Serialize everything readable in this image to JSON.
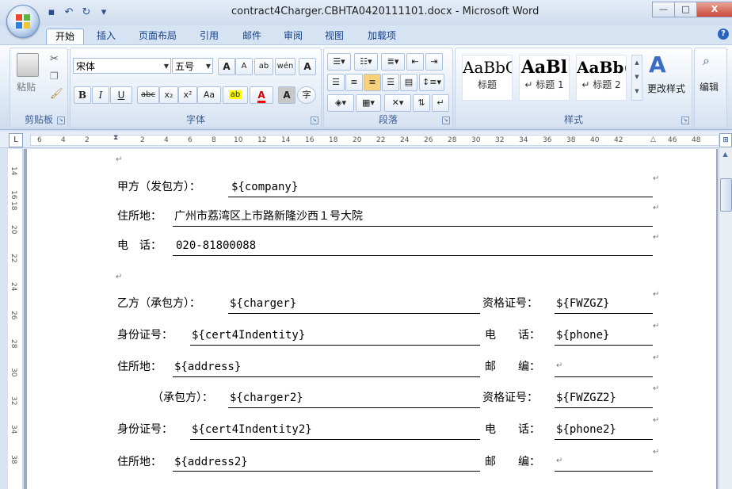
{
  "window": {
    "title": "contract4Charger.CBHTA0420111101.docx - Microsoft Word",
    "controls": {
      "minimize": "—",
      "maximize": "□",
      "close": "X"
    }
  },
  "quick_access": [
    {
      "icon": "save-icon",
      "glyph": "▪"
    },
    {
      "icon": "undo-icon",
      "glyph": "↶"
    },
    {
      "icon": "redo-icon",
      "glyph": "↻"
    },
    {
      "icon": "customize-icon",
      "glyph": "▾"
    }
  ],
  "tabs": [
    "开始",
    "插入",
    "页面布局",
    "引用",
    "邮件",
    "审阅",
    "视图",
    "加载项"
  ],
  "ribbon": {
    "clipboard": {
      "paste_label": "粘贴",
      "group_label": "剪贴板"
    },
    "font": {
      "group_label": "字体",
      "font_name": "宋体",
      "font_size": "五号",
      "grow": "A",
      "shrink": "A",
      "clear": "ab",
      "phonetic": "wén",
      "border_char": "A",
      "bold": "B",
      "italic": "I",
      "underline": "U",
      "strike": "abc",
      "subscript": "x₂",
      "superscript": "x²",
      "change_case": "Aa",
      "highlight": "ab",
      "font_color": "A",
      "shading_char": "A",
      "enclose": "字"
    },
    "paragraph": {
      "group_label": "段落"
    },
    "styles": {
      "group_label": "样式",
      "items": [
        {
          "sample": "AaBbC",
          "name": "标题"
        },
        {
          "sample": "AaBl",
          "name": "↵ 标题 1"
        },
        {
          "sample": "AaBb(",
          "name": "↵ 标题 2"
        }
      ],
      "change_styles": "更改样式"
    },
    "editing": {
      "label": "编辑"
    }
  },
  "colors": {
    "highlight": "#ffff00",
    "font_color": "#ff0000",
    "tab_text": "#15428b"
  },
  "ruler": {
    "marks": [
      "6",
      "4",
      "2",
      "",
      "2",
      "4",
      "6",
      "8",
      "10",
      "12",
      "14",
      "16",
      "18",
      "20",
      "22",
      "24",
      "26",
      "28",
      "30",
      "32",
      "34",
      "36",
      "38",
      "40",
      "42",
      "",
      "46",
      "48"
    ]
  },
  "vruler": {
    "marks": [
      "14",
      "16",
      "18",
      "20",
      "22",
      "24",
      "26",
      "28",
      "30",
      "32",
      "34",
      "36",
      "38"
    ]
  },
  "document": {
    "party_a_label": "甲方（发包方）：",
    "party_a_value": "${company}",
    "address_label": "住所地：",
    "address_value": "广州市荔湾区上市路新隆沙西１号大院",
    "phone_label": "电　话：",
    "phone_value": "020-81800088",
    "party_b1_label": "乙方（承包方）：",
    "party_b1_value": "${charger}",
    "cert_label": "资格证号：",
    "cert1_value": "${FWZGZ}",
    "id_label": "身份证号：",
    "id1_value": "${cert4Indentity}",
    "tel_label": "电　　话：",
    "tel1_value": "${phone}",
    "addr_label": "住所地：",
    "addr1_value": "${address}",
    "post_label": "邮　　编：",
    "party_b2_label": "（承包方）：",
    "party_b2_value": "${charger2}",
    "cert2_value": "${FWZGZ2}",
    "id2_value": "${cert4Indentity2}",
    "tel2_value": "${phone2}",
    "addr2_value": "${address2}",
    "para_mark": "↵"
  }
}
